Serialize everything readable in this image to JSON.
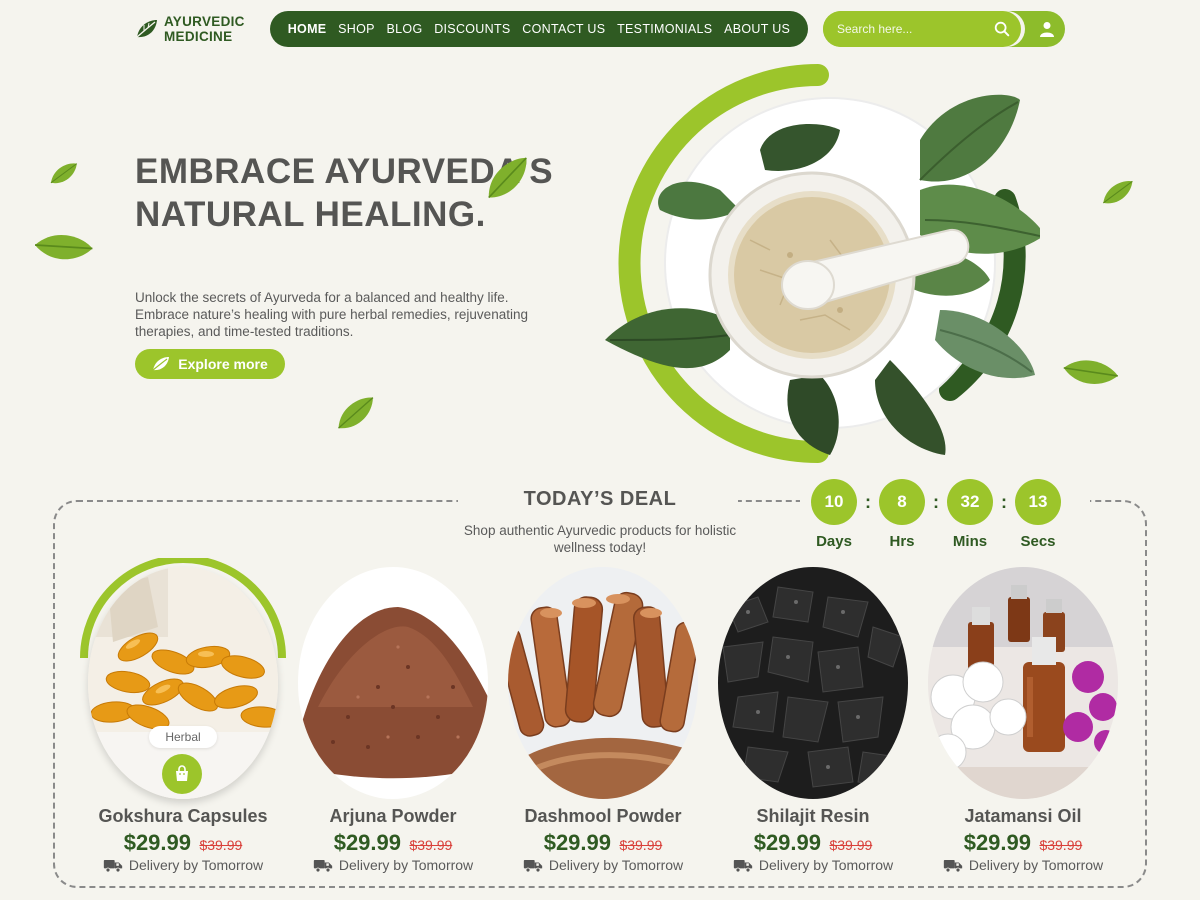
{
  "brand": {
    "name": "AYURVEDIC\nMEDICINE",
    "accent": "#9cc52b",
    "dark": "#2f5a22"
  },
  "nav": {
    "items": [
      {
        "label": "HOME",
        "active": true
      },
      {
        "label": "SHOP"
      },
      {
        "label": "BLOG"
      },
      {
        "label": "DISCOUNTS"
      },
      {
        "label": "CONTACT US"
      },
      {
        "label": "TESTIMONIALS"
      },
      {
        "label": "ABOUT US"
      }
    ]
  },
  "search": {
    "placeholder": "Search here...",
    "icon": "search-icon"
  },
  "user": {
    "icon": "user-icon"
  },
  "hero": {
    "title": "EMBRACE AYURVEDA’S NATURAL HEALING.",
    "description": "Unlock the secrets of Ayurveda for a balanced and healthy life. Embrace nature’s healing with pure herbal remedies, rejuvenating therapies, and time-tested traditions.",
    "cta_label": "Explore more",
    "cta_icon": "leaf-icon"
  },
  "deal": {
    "title": "TODAY’S DEAL",
    "subtitle": "Shop authentic Ayurvedic products for holistic wellness today!",
    "countdown": [
      {
        "value": "10",
        "label": "Days"
      },
      {
        "value": "8",
        "label": "Hrs"
      },
      {
        "value": "32",
        "label": "Mins"
      },
      {
        "value": "13",
        "label": "Secs"
      }
    ],
    "products": [
      {
        "name": "Gokshura Capsules",
        "price": "$29.99",
        "old_price": "$39.99",
        "delivery": "Delivery by Tomorrow",
        "badge": "Herbal",
        "image": "capsules"
      },
      {
        "name": "Arjuna Powder",
        "price": "$29.99",
        "old_price": "$39.99",
        "delivery": "Delivery by Tomorrow",
        "image": "powder"
      },
      {
        "name": "Dashmool Powder",
        "price": "$29.99",
        "old_price": "$39.99",
        "delivery": "Delivery by Tomorrow",
        "image": "cinnamon"
      },
      {
        "name": "Shilajit Resin",
        "price": "$29.99",
        "old_price": "$39.99",
        "delivery": "Delivery by Tomorrow",
        "image": "resin"
      },
      {
        "name": "Jatamansi Oil",
        "price": "$29.99",
        "old_price": "$39.99",
        "delivery": "Delivery by Tomorrow",
        "image": "oil"
      }
    ]
  }
}
